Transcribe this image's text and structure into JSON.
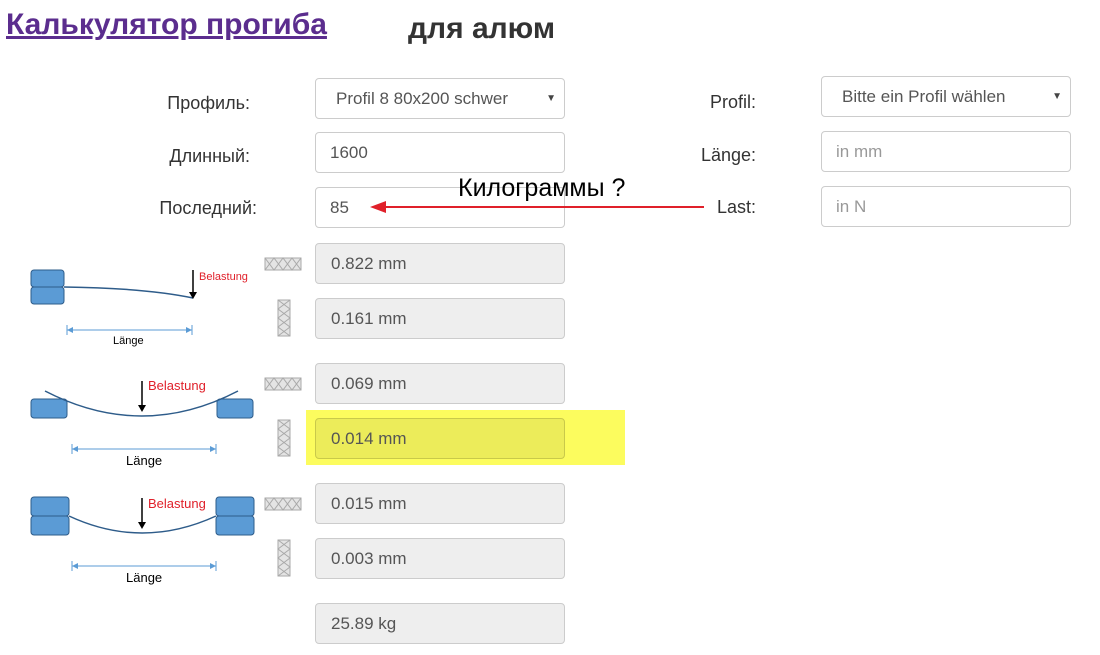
{
  "title": {
    "link": "Калькулятор прогиба",
    "rest": "для алюм"
  },
  "form_ru": {
    "profile_label": "Профиль:",
    "profile_value": "Profil 8 80x200 schwer",
    "length_label": "Длинный:",
    "length_value": "1600",
    "load_label": "Последний:",
    "load_value": "85"
  },
  "form_de": {
    "profile_label": "Profil:",
    "profile_value": "Bitte ein Profil wählen",
    "length_label": "Länge:",
    "length_placeholder": "in mm",
    "load_label": "Last:",
    "load_placeholder": "in N"
  },
  "annotation": {
    "text": "Килограммы ?",
    "color": "#e0202a"
  },
  "diagram_labels": {
    "load": "Belastung",
    "length": "Länge"
  },
  "results": {
    "cantilever_horizontal": "0.822 mm",
    "cantilever_vertical": "0.161 mm",
    "simple_horizontal": "0.069 mm",
    "simple_vertical": "0.014 mm",
    "fixed_horizontal": "0.015 mm",
    "fixed_vertical": "0.003 mm",
    "weight": "25.89 kg"
  },
  "colors": {
    "title_link": "#5b2d8e",
    "support_blue": "#5b9bd5",
    "highlight": "#fcfc5e",
    "load_text": "#e0202a"
  }
}
